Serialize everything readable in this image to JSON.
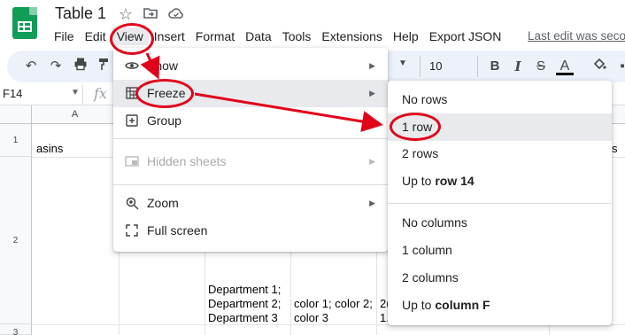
{
  "app": {
    "title": "Table 1",
    "icons": {
      "logo": "sheets-logo",
      "star": "star-icon",
      "move": "move-to-folder-icon",
      "cloud": "cloud-status-icon"
    },
    "last_edit": "Last edit was seco"
  },
  "menubar": [
    "File",
    "Edit",
    "View",
    "Insert",
    "Format",
    "Data",
    "Tools",
    "Extensions",
    "Help",
    "Export JSON"
  ],
  "toolbar": {
    "font_size": "10",
    "bold": "B",
    "italic": "I",
    "strike": "S",
    "text_color": "A"
  },
  "formula_bar": {
    "cell_ref": "F14",
    "fx": "fx"
  },
  "grid": {
    "columns": [
      "A"
    ],
    "rows": [
      "1",
      "2",
      "3"
    ],
    "cells": {
      "a1": "asins",
      "c2_line1": "Department 1;",
      "c2_line2": "Department 2;",
      "c2_line3": "Department 3",
      "d2_line1": "color 1; color 2;",
      "d2_line2": "color 3",
      "e2_line1": "2(",
      "e2_line2": "1.",
      "right_edge": "s"
    }
  },
  "view_menu": {
    "items": [
      {
        "label": "Show",
        "icon": "eye-icon",
        "submenu": true
      },
      {
        "label": "Freeze",
        "icon": "freeze-grid-icon",
        "submenu": true
      },
      {
        "label": "Group",
        "icon": "group-plus-icon",
        "submenu": false
      },
      {
        "label": "Hidden sheets",
        "icon": "hidden-sheet-icon",
        "submenu": true,
        "disabled": true
      },
      {
        "label": "Zoom",
        "icon": "zoom-icon",
        "submenu": true
      },
      {
        "label": "Full screen",
        "icon": "fullscreen-icon",
        "submenu": false
      }
    ]
  },
  "freeze_menu": {
    "items": [
      {
        "label": "No rows"
      },
      {
        "label": "1 row"
      },
      {
        "label": "2 rows"
      },
      {
        "prefix": "Up to ",
        "bold": "row 14"
      },
      {
        "label": "No columns"
      },
      {
        "label": "1 column"
      },
      {
        "label": "2 columns"
      },
      {
        "prefix": "Up to ",
        "bold": "column F"
      }
    ]
  },
  "colors": {
    "annotation": "#e2001a",
    "sheets_green": "#0f9d58",
    "hover": "#e8eaed"
  }
}
